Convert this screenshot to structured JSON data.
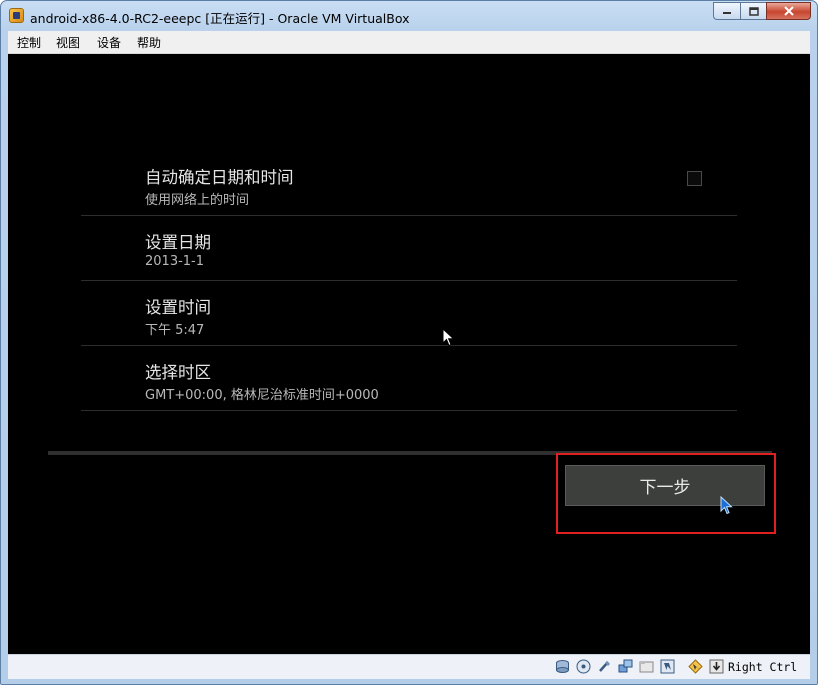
{
  "window": {
    "title": "android-x86-4.0-RC2-eeepc [正在运行] - Oracle VM VirtualBox",
    "controls": {
      "minimize_icon": "minimize-icon",
      "maximize_icon": "maximize-icon",
      "close_icon": "close-icon"
    }
  },
  "menu": [
    "控制",
    "视图",
    "设备",
    "帮助"
  ],
  "settings": [
    {
      "title": "自动确定日期和时间",
      "subtitle": "使用网络上的时间",
      "checked": false
    },
    {
      "title": "设置日期",
      "subtitle": "2013-1-1"
    },
    {
      "title": "设置时间",
      "subtitle": "下午 5:47"
    },
    {
      "title": "选择时区",
      "subtitle": "GMT+00:00, 格林尼治标准时间+0000"
    }
  ],
  "next_button": {
    "label": "下一步"
  },
  "statusbar": {
    "icons": [
      "hard-disk-icon",
      "optical-drive-icon",
      "usb-icon",
      "network-icon",
      "shared-folders-icon",
      "capture-icon",
      "mouse-integration-icon",
      "keyboard-capture-icon"
    ],
    "host_key": "Right Ctrl"
  },
  "colors": {
    "highlight_border": "#e02020",
    "screen_bg": "#000000",
    "button_bg": "#3d3f3d"
  }
}
